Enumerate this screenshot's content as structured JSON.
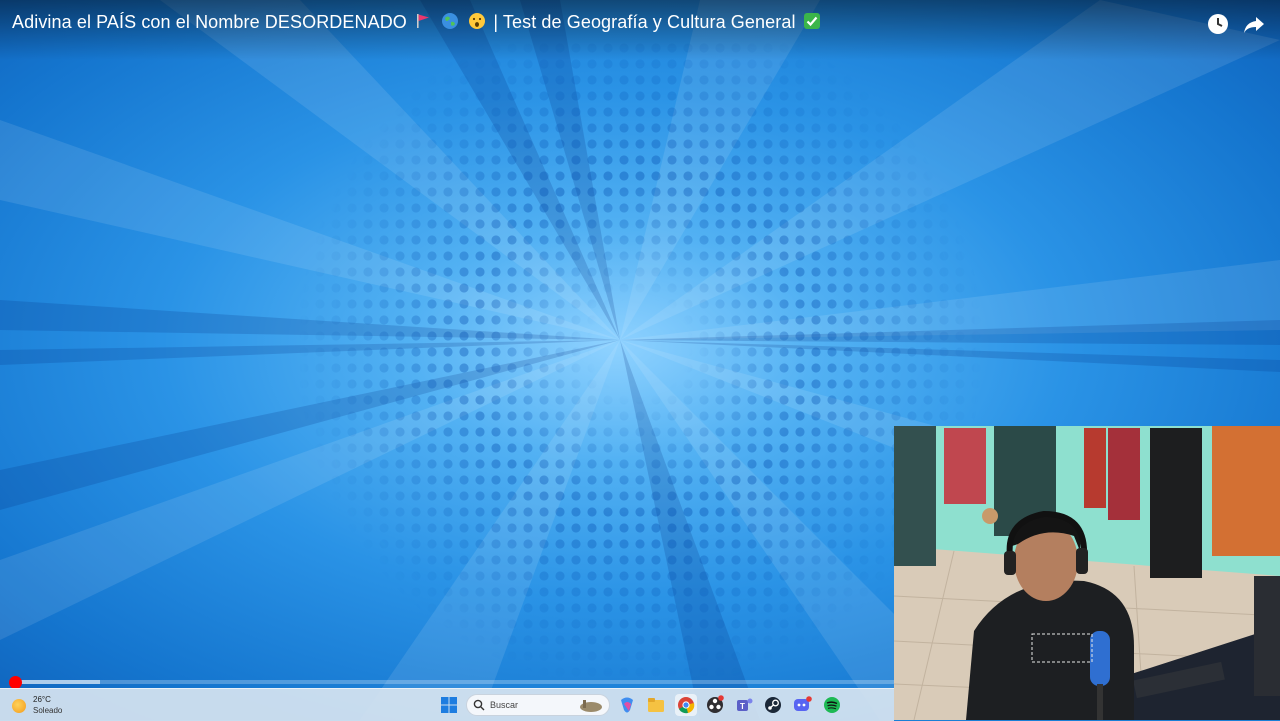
{
  "player": {
    "title": "Adivina el PAÍS con el Nombre DESORDENADO",
    "title_suffix": "| Test de Geografía y Cultura General",
    "watch_later_icon": "clock-icon",
    "share_icon": "share-icon",
    "progress_played": 0.005,
    "progress_buffered": 0.1
  },
  "taskbar": {
    "weather": {
      "temperature": "26°C",
      "condition": "Soleado",
      "icon": "sun-icon"
    },
    "search_placeholder": "Buscar",
    "apps": [
      "windows-start-icon",
      "search-icon",
      "copilot-icon",
      "file-explorer-icon",
      "chrome-icon",
      "obs-icon",
      "teams-icon",
      "steam-icon",
      "discord-icon",
      "spotify-icon"
    ]
  },
  "webcam": {
    "description_icon": "webcam-overlay"
  }
}
